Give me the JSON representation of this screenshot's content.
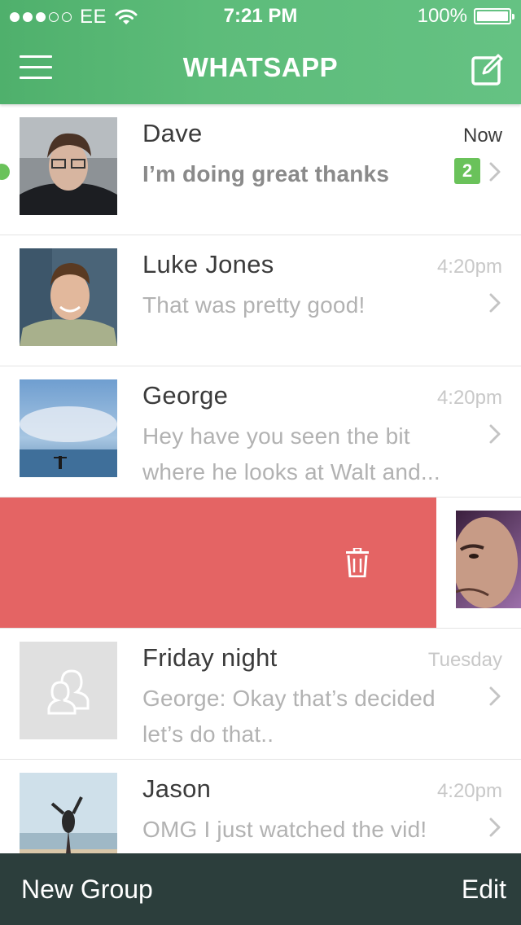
{
  "status_bar": {
    "carrier": "EE",
    "time": "7:21 PM",
    "battery": "100%",
    "signal_bars": 3,
    "signal_total": 5
  },
  "header": {
    "title": "WHATSAPP",
    "menu_icon": "hamburger-menu-icon",
    "compose_icon": "compose-icon"
  },
  "conversations": [
    {
      "name": "Dave",
      "time": "Now",
      "preview": "I’m doing great thanks",
      "unread": 2
    },
    {
      "name": "Luke Jones",
      "time": "4:20pm",
      "preview": "That was pretty good!"
    },
    {
      "name": "George",
      "time": "4:20pm",
      "preview_line1": "Hey have you seen the bit",
      "preview_line2": "where he looks at Walt and..."
    },
    {
      "name": "",
      "time": "",
      "preview": "",
      "swiped": true,
      "action_icon": "trash-icon"
    },
    {
      "name": "Friday night",
      "time": "Tuesday",
      "preview_line1": "George: Okay that’s decided",
      "preview_line2": "let’s do that.."
    },
    {
      "name": "Jason",
      "time": "4:20pm",
      "preview": "OMG I just watched the vid!"
    }
  ],
  "bottom_bar": {
    "new_group": "New Group",
    "edit": "Edit"
  },
  "colors": {
    "header_green": "#5dbc7a",
    "badge_green": "#6ac25a",
    "delete_red": "#e46464",
    "bottom_bar": "#2c3e3c"
  }
}
